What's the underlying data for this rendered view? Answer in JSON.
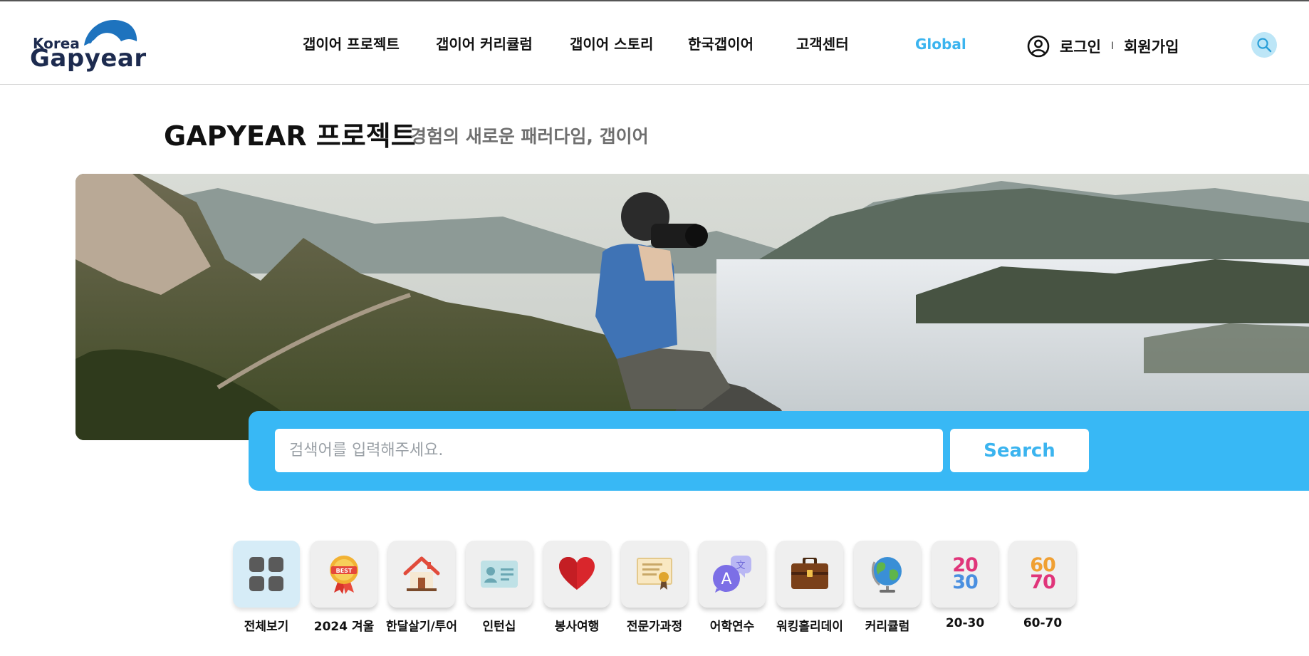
{
  "header": {
    "logo": {
      "top_text": "Korea",
      "main_text": "Gapyear"
    },
    "nav": [
      {
        "label": "갭이어 프로젝트"
      },
      {
        "label": "갭이어 커리큘럼"
      },
      {
        "label": "갭이어 스토리"
      },
      {
        "label": "한국갭이어"
      },
      {
        "label": "고객센터"
      },
      {
        "label": "Global"
      }
    ],
    "auth": {
      "login": "로그인",
      "separator": "I",
      "signup": "회원가입"
    },
    "accent_color": "#3bb4ef"
  },
  "page": {
    "title": "GAPYEAR 프로젝트",
    "subtitle": "경험의 새로운 패러다임, 갭이어"
  },
  "search": {
    "placeholder": "검색어를 입력해주세요.",
    "value": "",
    "button_label": "Search",
    "band_color": "#38b8f5"
  },
  "categories": [
    {
      "label": "전체보기",
      "icon": "grid-icon",
      "selected": true
    },
    {
      "label": "2024 겨울",
      "icon": "best-medal-icon"
    },
    {
      "label": "한달살기/투어",
      "icon": "house-icon"
    },
    {
      "label": "인턴십",
      "icon": "id-card-icon"
    },
    {
      "label": "봉사여행",
      "icon": "heart-icon"
    },
    {
      "label": "전문가과정",
      "icon": "certificate-icon"
    },
    {
      "label": "어학연수",
      "icon": "language-bubble-icon"
    },
    {
      "label": "워킹홀리데이",
      "icon": "briefcase-icon"
    },
    {
      "label": "커리큘럼",
      "icon": "globe-icon"
    },
    {
      "label": "20-30",
      "icon": "age-20-30-icon",
      "icon_text": [
        "20",
        "30"
      ]
    },
    {
      "label": "60-70",
      "icon": "age-60-70-icon",
      "icon_text": [
        "60",
        "70"
      ]
    }
  ]
}
